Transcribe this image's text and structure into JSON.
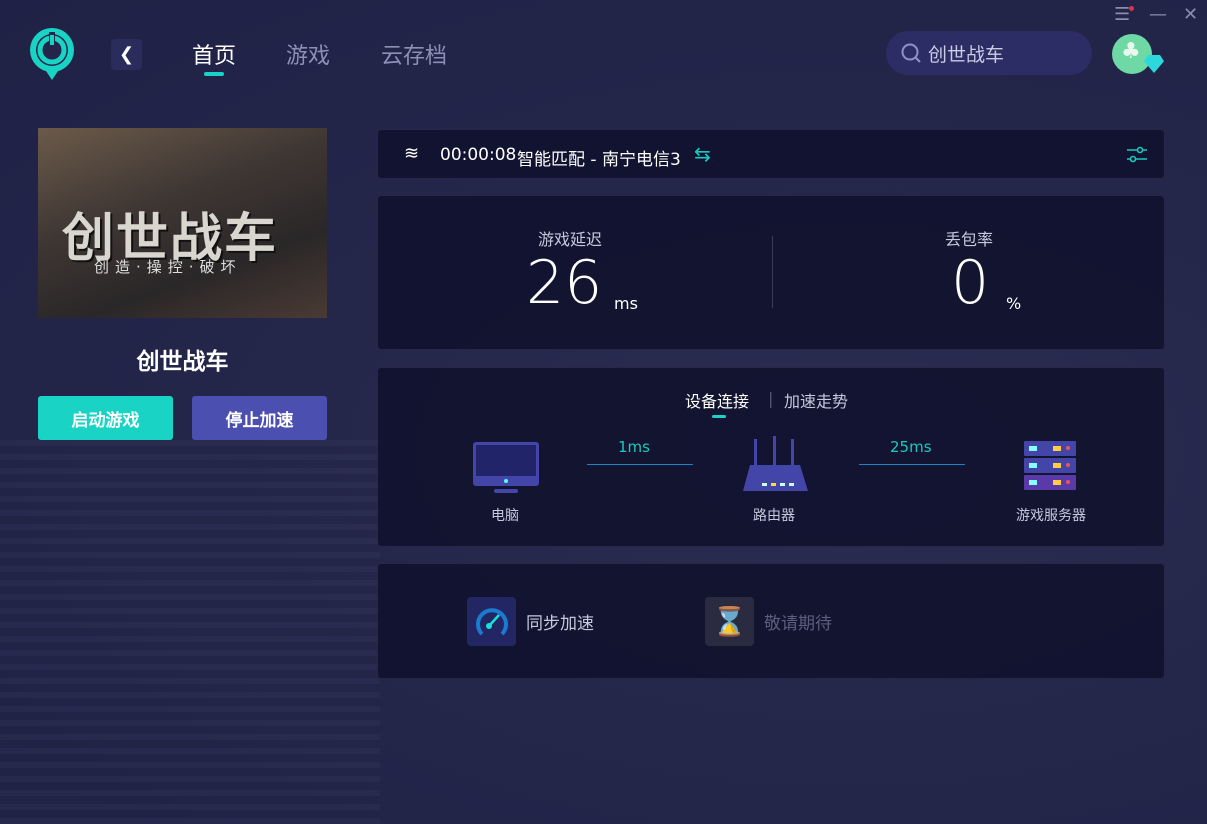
{
  "nav": {
    "tabs": [
      {
        "label": "首页"
      },
      {
        "label": "游戏"
      },
      {
        "label": "云存档"
      }
    ]
  },
  "search": {
    "value": "创世战车"
  },
  "game": {
    "name": "创世战车",
    "logo_text": "创世战车",
    "logo_subtitle": "创造·操控·破坏",
    "start_label": "启动游戏",
    "stop_label": "停止加速"
  },
  "status": {
    "time": "00:00:08",
    "route": "智能匹配 - 南宁电信3"
  },
  "stats": {
    "latency_label": "游戏延迟",
    "latency": "26",
    "latency_unit": "ms",
    "loss_label": "丢包率",
    "loss": "0",
    "loss_unit": "%"
  },
  "connection": {
    "tabs": [
      {
        "label": "设备连接"
      },
      {
        "label": "加速走势"
      }
    ],
    "pc": "电脑",
    "router": "路由器",
    "server": "游戏服务器",
    "pc_router": "1ms",
    "router_server": "25ms"
  },
  "features": {
    "sync": "同步加速",
    "coming": "敬请期待"
  },
  "colors": {
    "accent": "#19d3c5",
    "stop": "#4b4fb0"
  }
}
